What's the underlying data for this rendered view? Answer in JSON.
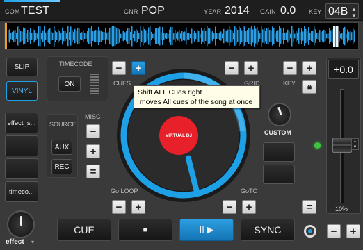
{
  "top": {
    "com_label": "COM",
    "com_value": "TEST",
    "genre_label": "GNR",
    "genre_value": "POP",
    "year_label": "YEAR",
    "year_value": "2014",
    "gain_label": "GAIN",
    "gain_value": "0.0",
    "key_label": "KEY",
    "key_value": "04B"
  },
  "left": {
    "slip": "SLIP",
    "vinyl": "VINYL",
    "effect_slot_1": "effect_s...",
    "timecode_slot": "timeco...",
    "effect_knob_label": "effect"
  },
  "timecode": {
    "title": "TIMECODE",
    "on": "ON"
  },
  "source": {
    "title": "SOURCE",
    "aux": "AUX",
    "rec": "REC"
  },
  "misc": {
    "title": "MISC",
    "minus": "−",
    "plus": "+",
    "equals": "="
  },
  "cues": {
    "label": "CUES",
    "minus": "−",
    "plus": "+"
  },
  "grid": {
    "label": "GRID",
    "minus": "−",
    "plus": "+"
  },
  "key": {
    "label": "KEY",
    "minus": "−",
    "plus": "+"
  },
  "tooltip": {
    "line1": "Shift ALL Cues right",
    "line2": " moves All cues of the song at once"
  },
  "platter": {
    "logo": "VIRTUAL DJ"
  },
  "custom": {
    "label": "CUSTOM"
  },
  "goloop": {
    "label": "Go LOOP",
    "minus": "−",
    "plus": "+"
  },
  "goto": {
    "label": "GoTO",
    "minus": "−",
    "plus": "+"
  },
  "equals_right": "=",
  "pitch": {
    "value": "+0.0",
    "range": "10%",
    "minus": "−",
    "plus": "+"
  },
  "transport": {
    "cue": "CUE",
    "stop": "■",
    "play": "II ▶",
    "sync": "SYNC"
  },
  "colors": {
    "accent": "#1ea0e6",
    "background": "#3a3a3a",
    "platter": "#2b2b2b",
    "logo": "#e8202a"
  }
}
